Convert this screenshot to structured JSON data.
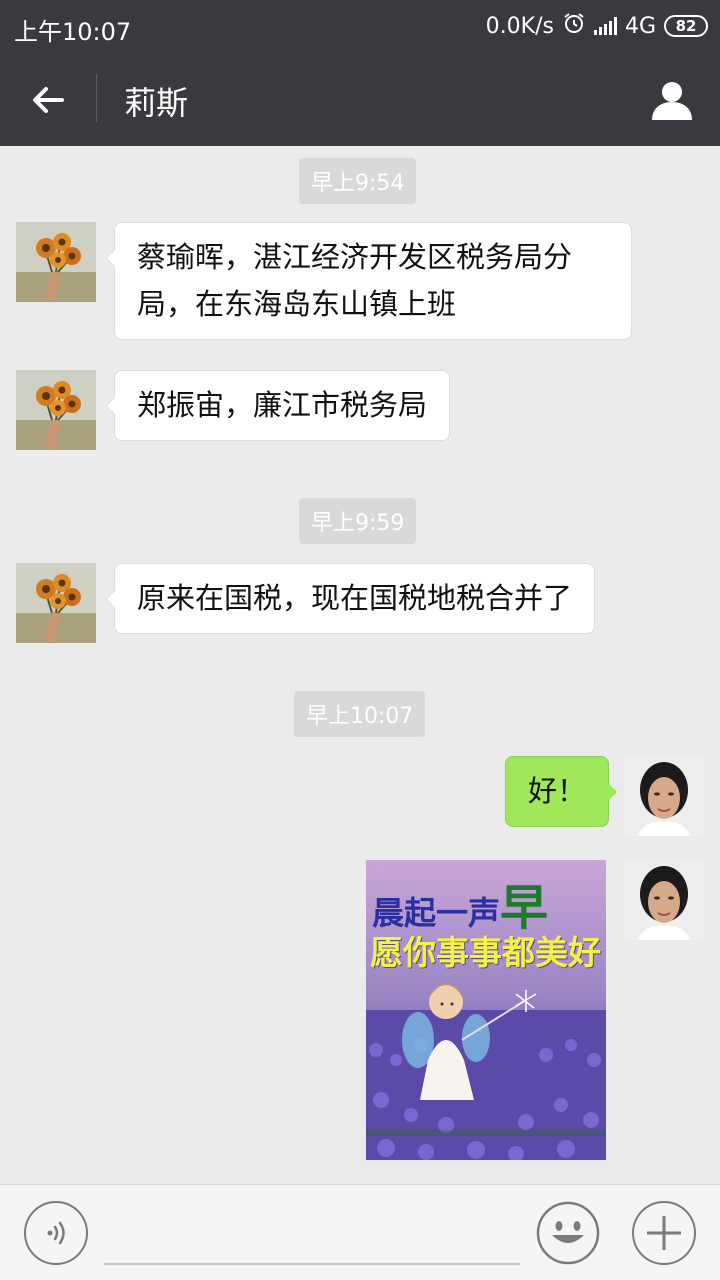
{
  "status_bar": {
    "time": "上午10:07",
    "network_speed": "0.0K/s",
    "network_type": "4G",
    "battery": "82",
    "icons": [
      "alarm-icon",
      "signal-icon",
      "battery-icon"
    ]
  },
  "header": {
    "title": "莉斯",
    "back_icon": "arrow-left-icon",
    "profile_icon": "person-icon"
  },
  "messages": [
    {
      "type": "timestamp",
      "text": "早上9:54"
    },
    {
      "type": "text",
      "side": "left",
      "text": "蔡瑜晖，湛江经济开发区税务局分局，在东海岛东山镇上班"
    },
    {
      "type": "text",
      "side": "left",
      "text": "郑振宙，廉江市税务局"
    },
    {
      "type": "timestamp",
      "text": "早上9:59"
    },
    {
      "type": "text",
      "side": "left",
      "text": "原来在国税，现在国税地税合并了"
    },
    {
      "type": "timestamp",
      "text": "早上10:07"
    },
    {
      "type": "text",
      "side": "right",
      "text": "好！"
    },
    {
      "type": "image",
      "side": "right",
      "caption_line1": "晨起一声",
      "caption_big": "早",
      "caption_line2": "愿你事事都美好"
    }
  ],
  "input_bar": {
    "voice_icon": "voice-icon",
    "input_value": "",
    "emoji_icon": "emoji-icon",
    "plus_icon": "plus-icon"
  },
  "colors": {
    "header_bg": "#393a3f",
    "chat_bg": "#ebebeb",
    "sent_bubble": "#a0e75a",
    "received_bubble": "#ffffff",
    "timestamp_bg": "#d9d9d9"
  }
}
